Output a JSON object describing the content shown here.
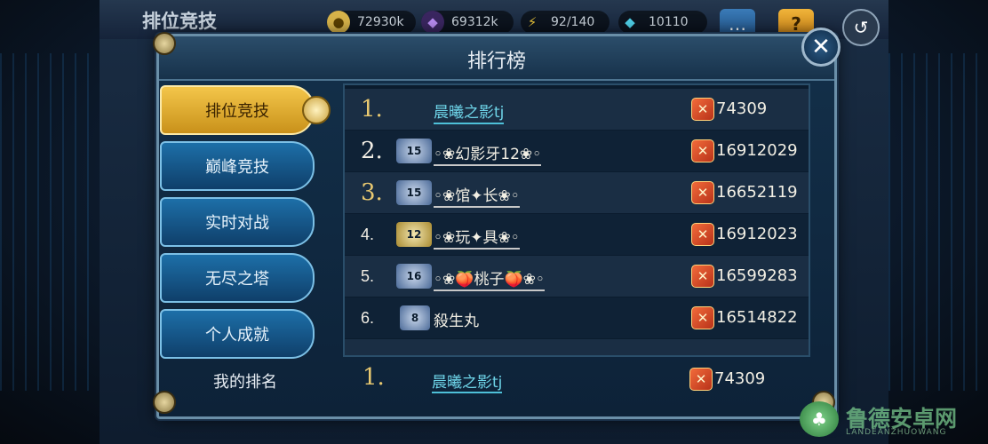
{
  "screen": {
    "title": "排位竞技",
    "resources": [
      {
        "icon": "gold-coin-icon",
        "glyph": "●",
        "value": "72930k",
        "color": "#d7b34a"
      },
      {
        "icon": "purple-gem-icon",
        "glyph": "◆",
        "value": "69312k",
        "color": "#8b5cd6"
      },
      {
        "icon": "energy-icon",
        "glyph": "⚡",
        "value": "92/140",
        "color": "#e8c33a"
      },
      {
        "icon": "diamond-icon",
        "glyph": "◆",
        "value": "10110",
        "color": "#4fd0e8"
      }
    ],
    "chat_glyph": "…",
    "help_glyph": "?",
    "back_glyph": "↺"
  },
  "panel": {
    "title": "排行榜",
    "close_glyph": "✕"
  },
  "tabs": [
    {
      "label": "排位竞技",
      "active": true
    },
    {
      "label": "巅峰竞技",
      "active": false
    },
    {
      "label": "实时对战",
      "active": false
    },
    {
      "label": "无尽之塔",
      "active": false
    },
    {
      "label": "个人成就",
      "active": false
    }
  ],
  "leaderboard": [
    {
      "rank": "1.",
      "badge": "",
      "name": "晨曦之影tj",
      "score": "74309",
      "first": true
    },
    {
      "rank": "2.",
      "badge": "15",
      "name": "◦❀幻影牙12❀◦",
      "score": "16912029",
      "first": false
    },
    {
      "rank": "3.",
      "badge": "15",
      "name": "◦❀馆✦长❀◦",
      "score": "16652119",
      "first": false
    },
    {
      "rank": "4.",
      "badge": "12",
      "name": "◦❀玩✦具❀◦",
      "score": "16912023",
      "first": false
    },
    {
      "rank": "5.",
      "badge": "16",
      "name": "◦❀🍑桃子🍑❀◦",
      "score": "16599283",
      "first": false
    },
    {
      "rank": "6.",
      "badge": "8",
      "name": "殺生丸",
      "score": "16514822",
      "first": false
    }
  ],
  "my_rank": {
    "label": "我的排名",
    "rank": "1.",
    "name": "晨曦之影tj",
    "score": "74309"
  },
  "score_icon_glyph": "✕",
  "watermark": {
    "text": "鲁德安卓网",
    "sub": "LANDEANZHUOWANG",
    "logo_glyph": "♣"
  }
}
